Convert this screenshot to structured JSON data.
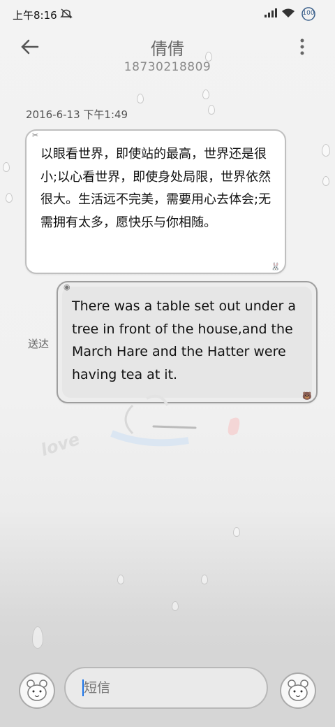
{
  "status_bar": {
    "time": "上午8:16",
    "battery": "100"
  },
  "header": {
    "contact_name": "倩倩",
    "phone": "18730218809"
  },
  "conversation": {
    "timestamp": "2016-6-13 下午1:49",
    "incoming": {
      "text": "以眼看世界，即使站的最高，世界还是很小;以心看世界，即使身处局限，世界依然很大。生活远不完美，需要用心去体会;无需拥有太多，愿快乐与你相随。"
    },
    "outgoing": {
      "text": "There was a table set out under a tree in front of the house,and the March Hare and the Hatter were having tea at it.",
      "status": "送达"
    }
  },
  "background_art": {
    "text": "love"
  },
  "composer": {
    "placeholder": "短信"
  },
  "colors": {
    "accent": "#1a73e8",
    "bubble_border": "#bfbfbf"
  },
  "icons": [
    "back-arrow-icon",
    "more-vert-icon",
    "wifi-icon",
    "signal-icon",
    "battery-icon",
    "mute-icon",
    "bear-emoji-icon"
  ]
}
